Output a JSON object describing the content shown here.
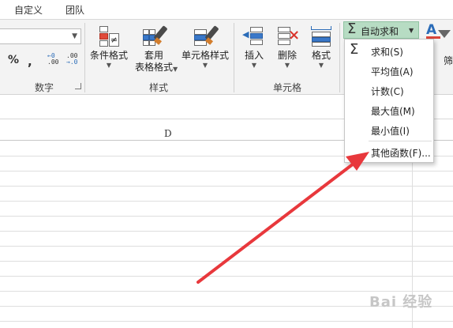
{
  "tabs": [
    {
      "label": "自定义"
    },
    {
      "label": "团队"
    }
  ],
  "ribbon": {
    "number_group": {
      "label": "数字",
      "percent_symbol": "%",
      "comma_symbol": ",",
      "increase_decimal_top": "←0",
      "increase_decimal_bottom": ".00",
      "decrease_decimal_top": ".00",
      "decrease_decimal_bottom": "→.0"
    },
    "styles_group": {
      "label": "样式",
      "conditional_format": "条件格式",
      "table_format_line1": "套用",
      "table_format_line2": "表格格式",
      "cell_styles": "单元格样式"
    },
    "cells_group": {
      "label": "单元格",
      "insert": "插入",
      "delete": "删除",
      "format": "格式"
    },
    "editing": {
      "autosum_symbol": "Σ",
      "autosum_label": "自动求和",
      "clipped_label": "筛"
    }
  },
  "grid": {
    "column_header": "D"
  },
  "autosum_menu": {
    "items": [
      {
        "label": "求和(S)",
        "icon": "sigma-icon"
      },
      {
        "label": "平均值(A)"
      },
      {
        "label": "计数(C)"
      },
      {
        "label": "最大值(M)"
      },
      {
        "label": "最小值(I)"
      },
      {
        "label": "其他函数(F)..."
      }
    ]
  },
  "watermark": {
    "text": "Bai 经验"
  },
  "colors": {
    "autosum_highlight": "#b7dcc3",
    "arrow": "#e8383c",
    "ribbon_bg": "#f3f3f3"
  }
}
